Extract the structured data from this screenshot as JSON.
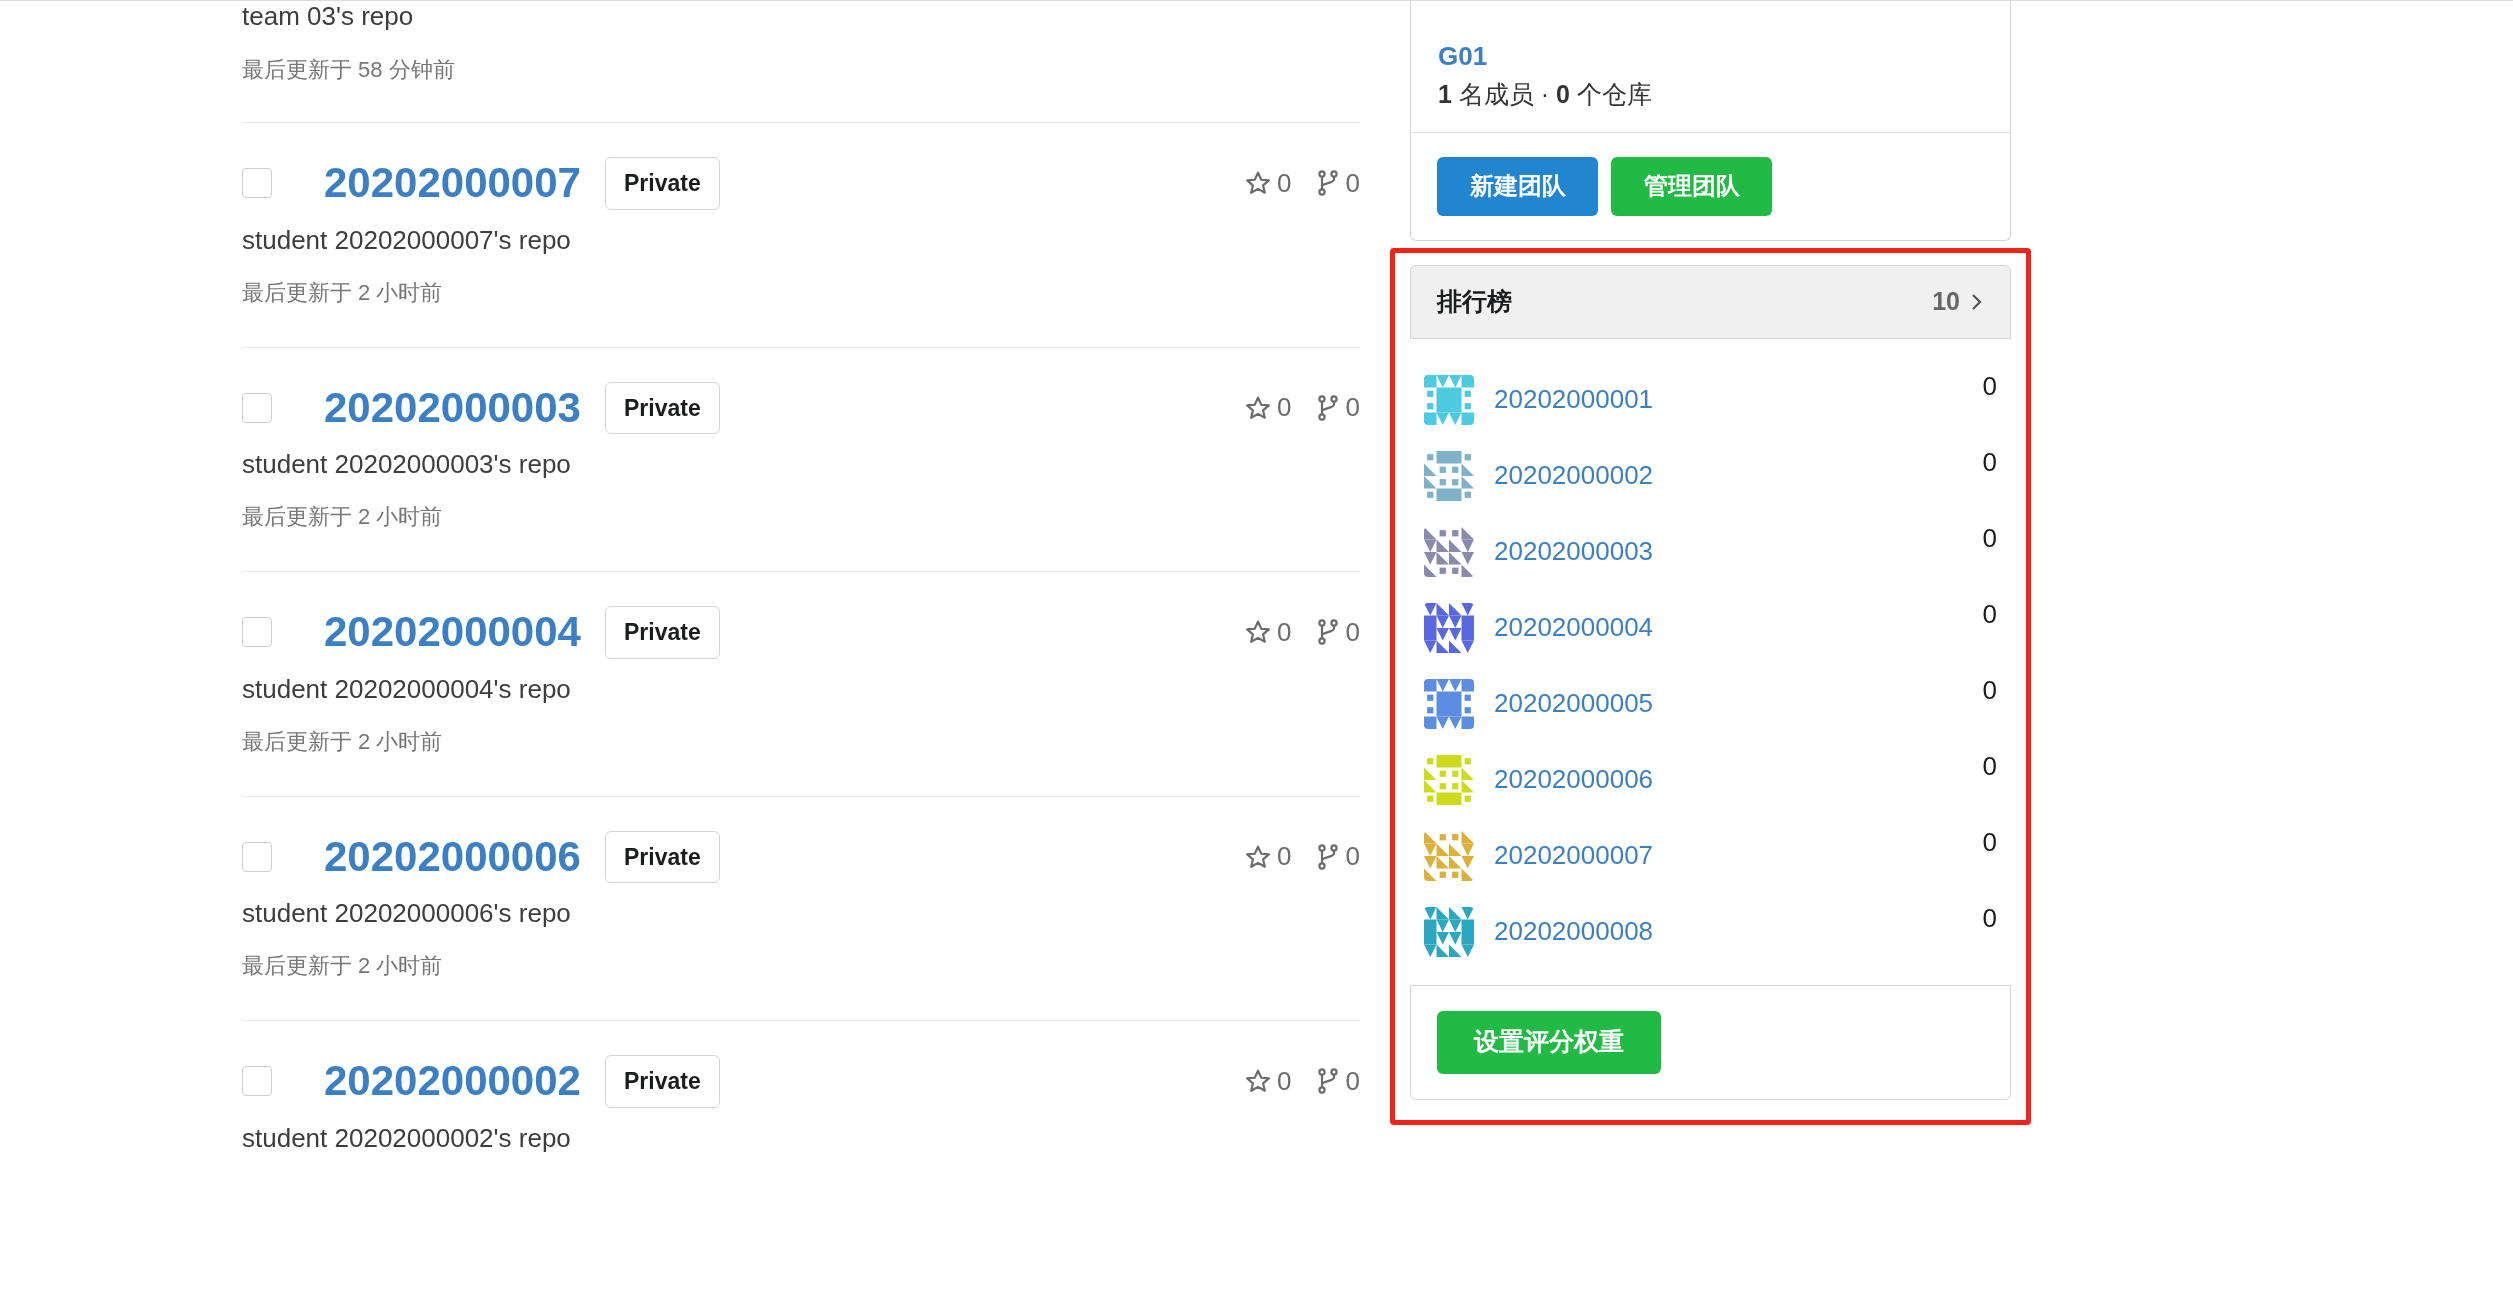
{
  "partial_repo": {
    "description": "team 03's repo",
    "updated": "最后更新于 58 分钟前"
  },
  "repos": [
    {
      "name": "20202000007",
      "visibility": "Private",
      "checked": false,
      "star_count": "0",
      "fork_count": "0",
      "description": "student 20202000007's repo",
      "updated": "最后更新于 2 小时前"
    },
    {
      "name": "20202000003",
      "visibility": "Private",
      "checked": false,
      "star_count": "0",
      "fork_count": "0",
      "description": "student 20202000003's repo",
      "updated": "最后更新于 2 小时前"
    },
    {
      "name": "20202000004",
      "visibility": "Private",
      "checked": false,
      "star_count": "0",
      "fork_count": "0",
      "description": "student 20202000004's repo",
      "updated": "最后更新于 2 小时前"
    },
    {
      "name": "20202000006",
      "visibility": "Private",
      "checked": false,
      "star_count": "0",
      "fork_count": "0",
      "description": "student 20202000006's repo",
      "updated": "最后更新于 2 小时前"
    },
    {
      "name": "20202000002",
      "visibility": "Private",
      "checked": false,
      "star_count": "0",
      "fork_count": "0",
      "description": "student 20202000002's repo"
    }
  ],
  "team": {
    "name": "G01",
    "summary": "**1** 名成员 · **0** 个仓库",
    "buttons": [
      {
        "label": "新建团队",
        "kind": "primary"
      },
      {
        "label": "管理团队",
        "kind": "success"
      }
    ]
  },
  "leaderboard": {
    "highlighted": true,
    "title": "排行榜",
    "count": "10",
    "items": [
      {
        "name": "20202000001",
        "score": "0",
        "color": "#4ccbe0"
      },
      {
        "name": "20202000002",
        "score": "0",
        "color": "#7fb1c8"
      },
      {
        "name": "20202000003",
        "score": "0",
        "color": "#8a8aac"
      },
      {
        "name": "20202000004",
        "score": "0",
        "color": "#5a68e0"
      },
      {
        "name": "20202000005",
        "score": "0",
        "color": "#5b8ee0"
      },
      {
        "name": "20202000006",
        "score": "0",
        "color": "#cddc1a"
      },
      {
        "name": "20202000007",
        "score": "0",
        "color": "#ddb03c"
      },
      {
        "name": "20202000008",
        "score": "0",
        "color": "#2aa8bf"
      }
    ],
    "action_button": "设置评分权重"
  }
}
